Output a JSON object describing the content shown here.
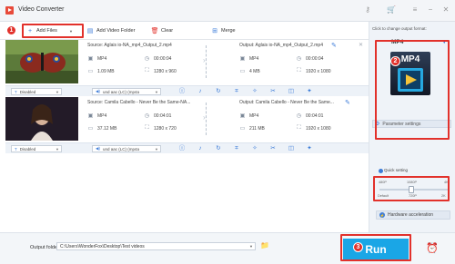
{
  "window": {
    "title": "Video Converter"
  },
  "toolbar": {
    "add_files_label": "Add Files",
    "add_folder_label": "Add Video Folder",
    "clear_label": "Clear",
    "merge_label": "Merge"
  },
  "steps": {
    "one": "1",
    "two": "2",
    "three": "3"
  },
  "files": [
    {
      "source": "Source: Aglais io-NA_mp4_Output_2.mp4",
      "output": "Output: Aglais io-NA_mp4_Output_2.mp4",
      "src_format": "MP4",
      "src_duration": "00:00:04",
      "src_size": "1.09 MB",
      "src_resolution": "1280 x 960",
      "out_format": "MP4",
      "out_duration": "00:00:04",
      "out_size": "4 MB",
      "out_resolution": "1920 x 1080",
      "subtitle": "Disabled",
      "audio": "und aac (LC) (mp4a"
    },
    {
      "source": "Source: Camila Cabello - Never Be the Same-NA...",
      "output": "Output: Camila Cabello - Never Be the Same...",
      "src_format": "MP4",
      "src_duration": "00:04:01",
      "src_size": "37.12 MB",
      "src_resolution": "1280 x 720",
      "out_format": "MP4",
      "out_duration": "00:04:01",
      "out_size": "211 MB",
      "out_resolution": "1920 x 1080",
      "subtitle": "Disabled",
      "audio": "und aac (LC) (mp4a"
    }
  ],
  "side": {
    "format_hint": "Click to change output format:",
    "format_name": "MP4",
    "format_art": "MP4",
    "param_label": "Parameter settings",
    "quick_label": "Quick setting",
    "ticks": [
      "480P",
      "1080P",
      "4K"
    ],
    "ends": [
      "Default",
      "720P",
      "2K"
    ],
    "quick_level_fraction": 0.45,
    "hw_label": "Hardware acceleration"
  },
  "footer": {
    "output_label": "Output folder:",
    "output_path": "C:\\Users\\WonderFox\\Desktop\\Test videos",
    "run_label": "Run"
  },
  "icons": {
    "app": "app-logo-icon",
    "key": "key-icon",
    "cart": "cart-icon",
    "menu": "menu-icon",
    "minimize": "minimize-icon",
    "close": "close-icon",
    "folder": "folder-icon",
    "alarm": "alarm-icon"
  },
  "colors": {
    "accent": "#1aa6e6",
    "highlight": "#e2312b",
    "brand_blue": "#3b7bd8"
  }
}
